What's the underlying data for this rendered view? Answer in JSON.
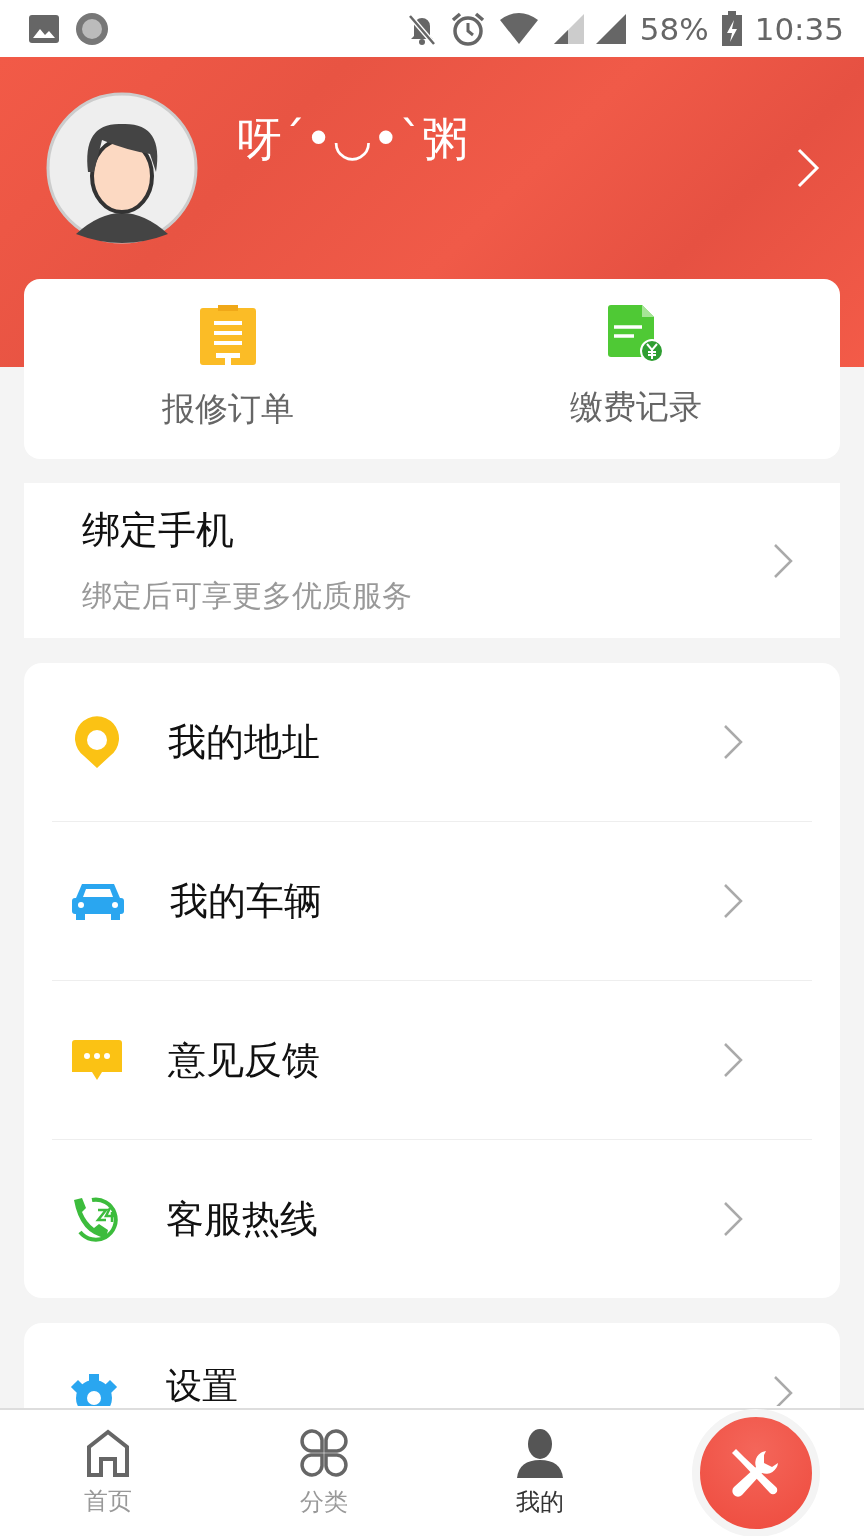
{
  "status_bar": {
    "battery": "58%",
    "time": "10:35"
  },
  "profile": {
    "name": "呀´•◡•`粥"
  },
  "shortcuts": [
    {
      "label": "报修订单",
      "kind": "repair"
    },
    {
      "label": "缴费记录",
      "kind": "payment"
    }
  ],
  "bind_phone": {
    "title": "绑定手机",
    "subtitle": "绑定后可享更多优质服务"
  },
  "menu": [
    {
      "label": "我的地址",
      "kind": "location"
    },
    {
      "label": "我的车辆",
      "kind": "car"
    },
    {
      "label": "意见反馈",
      "kind": "feedback"
    },
    {
      "label": "客服热线",
      "kind": "hotline"
    }
  ],
  "settings": {
    "label": "设置"
  },
  "tabs": [
    {
      "label": "首页",
      "kind": "home",
      "selected": false
    },
    {
      "label": "分类",
      "kind": "category",
      "selected": false
    },
    {
      "label": "我的",
      "kind": "profile",
      "selected": true
    }
  ]
}
